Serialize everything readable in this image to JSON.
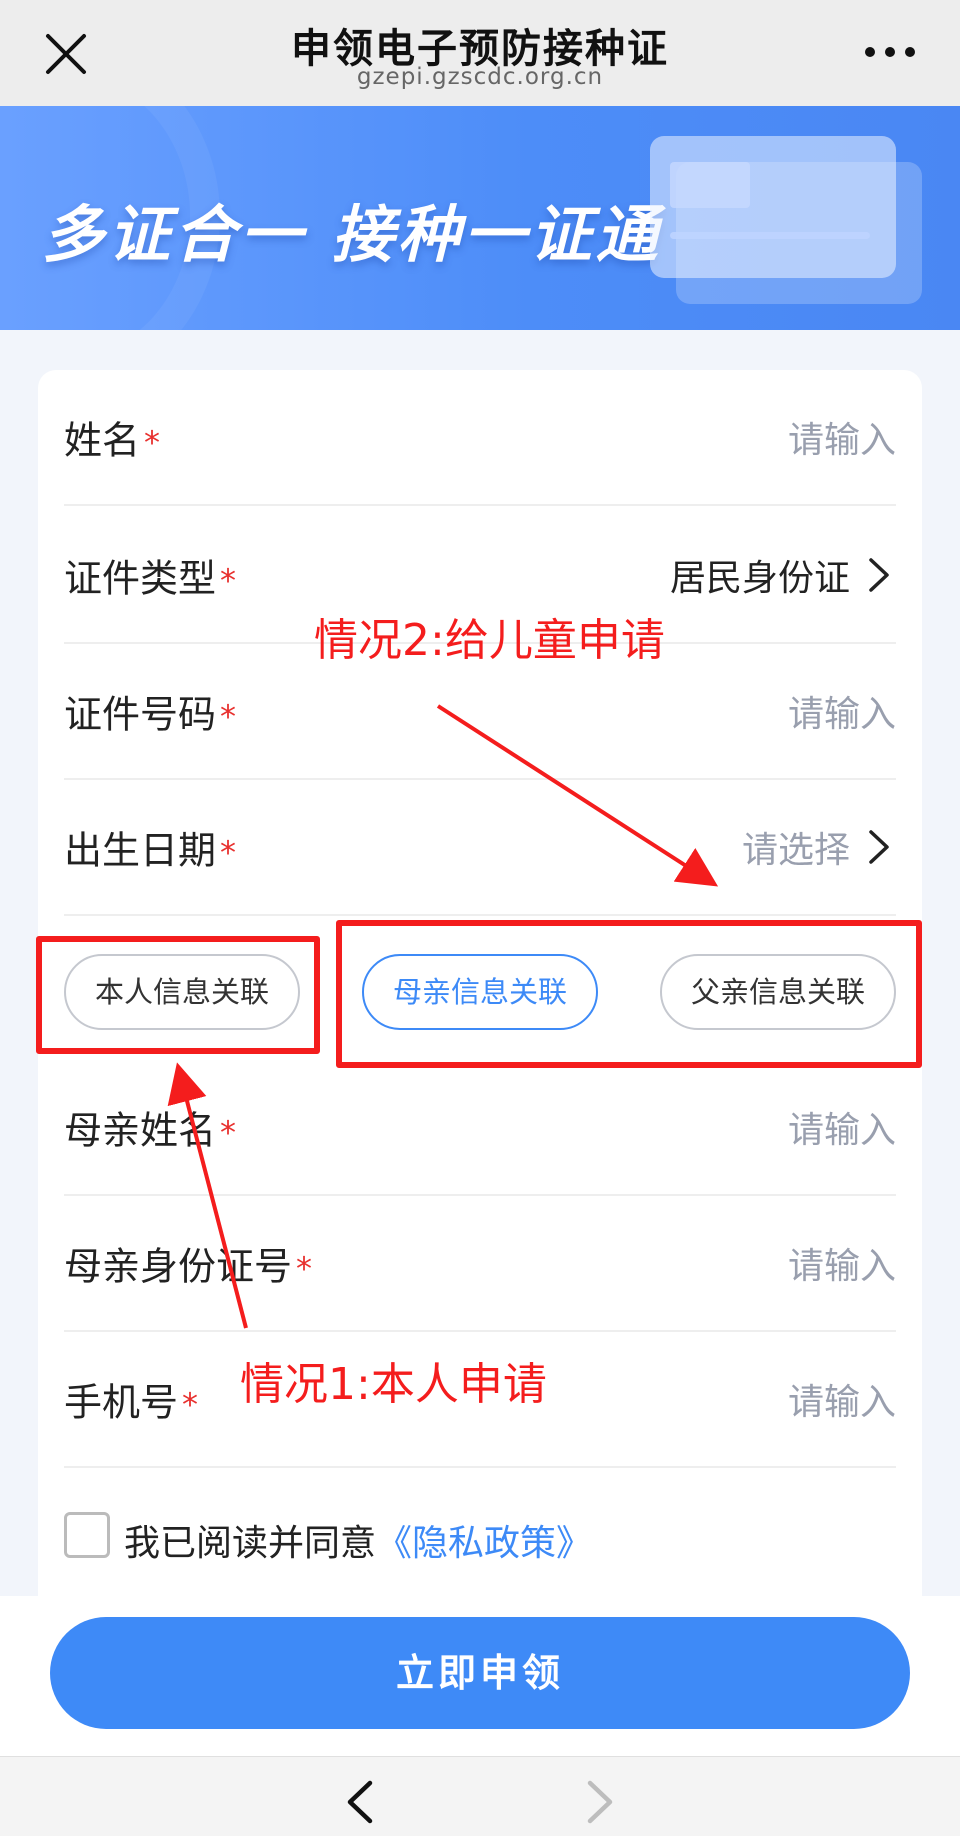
{
  "nav": {
    "title": "申领电子预防接种证",
    "url": "gzepi.gzscdc.org.cn"
  },
  "banner": {
    "slogan": "多证合一 接种一证通"
  },
  "form": {
    "required_mark": "*",
    "fields": [
      {
        "label": "姓名",
        "value": "请输入"
      },
      {
        "label": "证件类型",
        "value": "居民身份证"
      },
      {
        "label": "证件号码",
        "value": "请输入"
      },
      {
        "label": "出生日期",
        "value": "请选择"
      },
      {
        "label": "母亲姓名",
        "value": "请输入"
      },
      {
        "label": "母亲身份证号",
        "value": "请输入"
      },
      {
        "label": "手机号",
        "value": "请输入"
      }
    ],
    "relation_options": [
      "本人信息关联",
      "母亲信息关联",
      "父亲信息关联"
    ],
    "relation_selected": "母亲信息关联",
    "agree_text": "我已阅读并同意",
    "privacy_link": "《隐私政策》",
    "agree_checked": false
  },
  "submit_label": "立即申领",
  "annotations": {
    "case_child": "情况2:给儿童申请",
    "case_self": "情况1:本人申请",
    "color": "#f41d1d"
  },
  "colors": {
    "accent": "#3e8af7",
    "banner": "#4d8df8",
    "required": "#e8302e",
    "placeholder": "#999fae"
  }
}
